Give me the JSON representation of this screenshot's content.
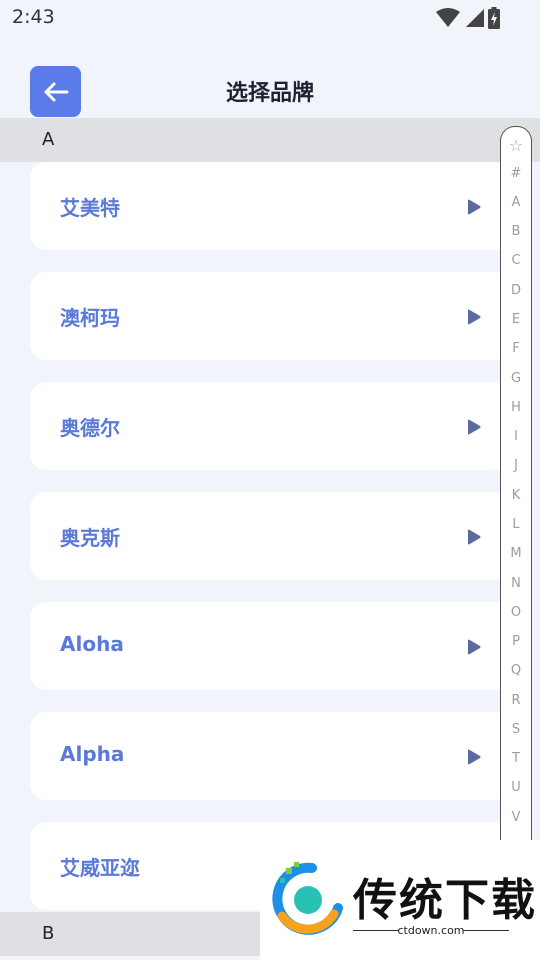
{
  "status_bar": {
    "time": "2:43"
  },
  "header": {
    "title": "选择品牌"
  },
  "sections": [
    {
      "letter": "A",
      "brands": [
        "艾美特",
        "澳柯玛",
        "奥德尔",
        "奥克斯",
        "Aloha",
        "Alpha",
        "艾威亚迩"
      ]
    },
    {
      "letter": "B",
      "brands": []
    }
  ],
  "index_bar": [
    "☆",
    "#",
    "A",
    "B",
    "C",
    "D",
    "E",
    "F",
    "G",
    "H",
    "I",
    "J",
    "K",
    "L",
    "M",
    "N",
    "O",
    "P",
    "Q",
    "R",
    "S",
    "T",
    "U",
    "V"
  ],
  "watermark": {
    "name": "传统下载",
    "url": "ctdown.com"
  },
  "colors": {
    "accent": "#5b7be8",
    "brand_text": "#5b79d9",
    "section_bg": "#dfe0e4",
    "page_bg": "#f1f4fb"
  },
  "icons": {
    "back": "arrow-left-icon",
    "item": "play-triangle-icon"
  }
}
